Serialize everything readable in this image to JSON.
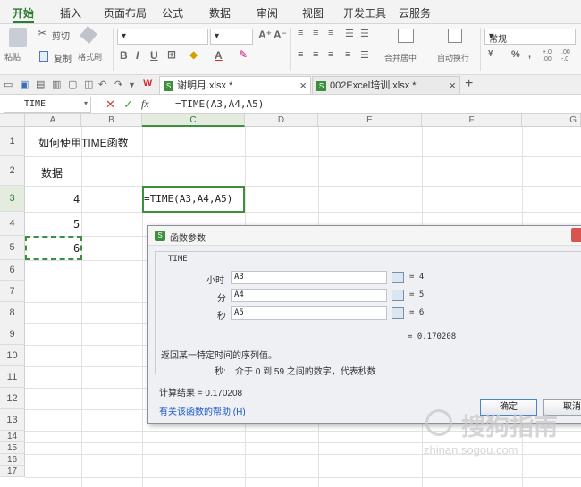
{
  "menu": [
    "开始",
    "插入",
    "页面布局",
    "公式",
    "数据",
    "审阅",
    "视图",
    "开发工具",
    "云服务"
  ],
  "ribbon": {
    "paste": "粘贴",
    "cut": "剪切",
    "copy": "复制",
    "format_painter": "格式刷",
    "bold": "B",
    "italic": "I",
    "underline": "U",
    "font_grow": "A⁺",
    "font_shrink": "A⁻",
    "font_color": "A",
    "merge_center": "合并居中",
    "wrap_text": "自动换行",
    "number_format": "常规",
    "percent": "%",
    "comma": ",",
    "dec_more": "+.0 .00",
    "dec_less": ".00 -.0"
  },
  "tabs": [
    {
      "label": "谢明月.xlsx *",
      "active": true
    },
    {
      "label": "002Excel培训.xlsx *",
      "active": false
    }
  ],
  "new_tab": "+",
  "formula_bar": {
    "name_box": "TIME",
    "cancel": "✕",
    "enter": "✓",
    "fx": "fx",
    "formula": "=TIME(A3,A4,A5)"
  },
  "columns": [
    "A",
    "B",
    "C",
    "D",
    "E",
    "F",
    "G"
  ],
  "rows": [
    "1",
    "2",
    "3",
    "4",
    "5",
    "6",
    "7",
    "8",
    "9",
    "10",
    "11",
    "12",
    "13",
    "14",
    "15",
    "16",
    "17"
  ],
  "cells": {
    "a1": "如何使用TIME函数",
    "a2": "数据",
    "a3": "4",
    "a4": "5",
    "a5": "6",
    "c3": "=TIME(A3,A4,A5)"
  },
  "dialog": {
    "title": "函数参数",
    "function_name": "TIME",
    "args": [
      {
        "label": "小时",
        "ref": "A3",
        "value": "= 4"
      },
      {
        "label": "分",
        "ref": "A4",
        "value": "= 5"
      },
      {
        "label": "秒",
        "ref": "A5",
        "value": "= 6"
      }
    ],
    "formula_result_inline": "= 0.170208",
    "description": "返回某一特定时间的序列值。",
    "arg_help_label": "秒:",
    "arg_help_text": "介于 0 到 59 之间的数字，代表秒数",
    "result_label": "计算结果 = 0.170208",
    "help_link": "有关该函数的帮助 (H)",
    "ok": "确定",
    "cancel": "取消"
  },
  "watermark": {
    "text": "搜狗指南",
    "url": "zhinan.sogou.com"
  },
  "colors": {
    "accent": "#2e7d32",
    "selection": "#3c8f3c",
    "link": "#1a56c8"
  }
}
